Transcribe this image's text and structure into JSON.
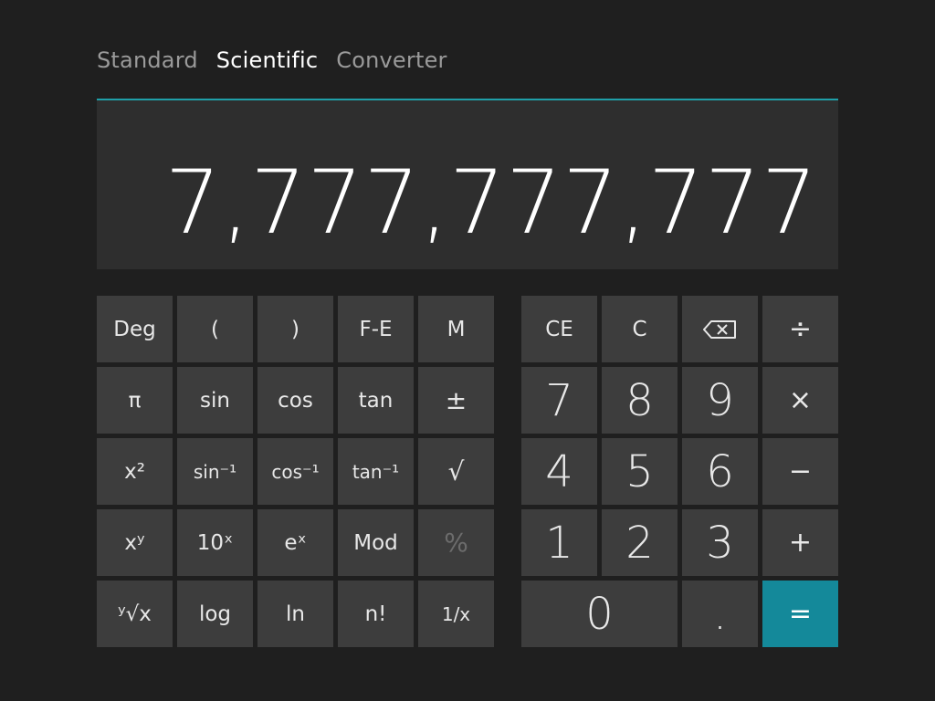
{
  "tabs": [
    "Standard",
    "Scientific",
    "Converter"
  ],
  "active_tab": "Scientific",
  "display": {
    "value": "7,777,777,777"
  },
  "scientific_keys": {
    "deg": "Deg",
    "open_paren": "(",
    "close_paren": ")",
    "fe": "F-E",
    "m": "M",
    "pi": "π",
    "sin": "sin",
    "cos": "cos",
    "tan": "tan",
    "plus_minus": "±",
    "x2": "x²",
    "asin": "sin⁻¹",
    "acos": "cos⁻¹",
    "atan": "tan⁻¹",
    "sqrt": "√",
    "xy": "xʸ",
    "ten_x": "10ˣ",
    "ex": "eˣ",
    "mod": "Mod",
    "percent": "%",
    "yroot": "ʸ√x",
    "log": "log",
    "ln": "ln",
    "factorial": "n!",
    "reciprocal": "1/x"
  },
  "standard_keys": {
    "ce": "CE",
    "c": "C",
    "divide": "÷",
    "seven": "7",
    "eight": "8",
    "nine": "9",
    "multiply": "×",
    "four": "4",
    "five": "5",
    "six": "6",
    "minus": "−",
    "one": "1",
    "two": "2",
    "three": "3",
    "plus": "+",
    "zero": "0",
    "decimal": ".",
    "equals": "="
  },
  "colors": {
    "accent": "#1f9fa8",
    "equals_bg": "#14899a",
    "key_bg": "#3d3d3d",
    "background": "#1f1f1f"
  }
}
